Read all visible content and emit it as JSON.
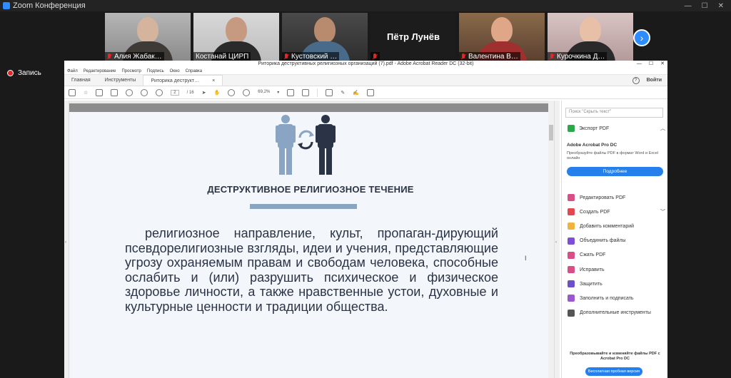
{
  "zoom": {
    "title": "Zoom Конференция",
    "record_label": "Запись",
    "participants": [
      {
        "name": "Алия Жабак…",
        "muted": true,
        "active": false,
        "video": true
      },
      {
        "name": "Костанай ЦИРП",
        "muted": false,
        "active": true,
        "video": true
      },
      {
        "name": "Кустовский …",
        "muted": true,
        "active": false,
        "video": true
      },
      {
        "name": "",
        "display": "Пётр Лунёв",
        "muted": true,
        "active": false,
        "video": false
      },
      {
        "name": "Валентина В…",
        "muted": true,
        "active": false,
        "video": true
      },
      {
        "name": "Курочкина Д…",
        "muted": true,
        "active": false,
        "video": true
      }
    ],
    "next_icon": "chevron-right-icon"
  },
  "acrobat": {
    "window_title": "Риторика деструктивных религиозных организаций (7).pdf - Adobe Acrobat Reader DC (32-bit)",
    "menu": [
      "Файл",
      "Редактирование",
      "Просмотр",
      "Подпись",
      "Окно",
      "Справка"
    ],
    "tabs": {
      "home": "Главная",
      "tools": "Инструменты",
      "doc": "Риторика деструкт…",
      "close": "×"
    },
    "signin": "Войти",
    "help": "?",
    "page_current": "2",
    "page_total": "/ 16",
    "zoom": "69,2%",
    "zoom_caret": "▾"
  },
  "document": {
    "heading": "ДЕСТРУКТИВНОЕ РЕЛИГИОЗНОЕ ТЕЧЕНИЕ",
    "definition": "религиозное направление, культ, пропаган-дирующий псевдорелигиозные взгляды, идеи и учения, представляющие угрозу охраняемым правам и свободам человека, способные ослабить и (или) разрушить психическое и физическое здоровье личности, а также нравственные устои, духовные и культурные ценности и традиции общества.",
    "colors": {
      "light_person": "#8aa4c4",
      "dark_person": "#2b3447",
      "text": "#2b3447"
    }
  },
  "sidebar": {
    "search_placeholder": "Поиск \"Скрыть текст\"",
    "export": "Экспорт PDF",
    "pro_title": "Adobe Acrobat Pro DC",
    "pro_desc": "Преобразуйте файлы PDF в формат Word и Excel онлайн",
    "pro_button": "Подробнее",
    "tools": [
      {
        "label": "Редактировать PDF",
        "color": "#d94e87",
        "chevron": false
      },
      {
        "label": "Создать PDF",
        "color": "#e34850",
        "chevron": true
      },
      {
        "label": "Добавить комментарий",
        "color": "#f0b43c",
        "chevron": false
      },
      {
        "label": "Объединить файлы",
        "color": "#7e4fd6",
        "chevron": false
      },
      {
        "label": "Сжать PDF",
        "color": "#d94e87",
        "chevron": false
      },
      {
        "label": "Исправить",
        "color": "#d94e87",
        "chevron": false
      },
      {
        "label": "Защитить",
        "color": "#6b50c9",
        "chevron": false
      },
      {
        "label": "Заполнить и подписать",
        "color": "#9b57d0",
        "chevron": false
      },
      {
        "label": "Дополнительные инструменты",
        "color": "#555555",
        "chevron": false
      }
    ],
    "promo_text": "Преобразовывайте и изменяйте файлы PDF с Acrobat Pro DC",
    "promo_button": "Бесплатная пробная версия"
  }
}
